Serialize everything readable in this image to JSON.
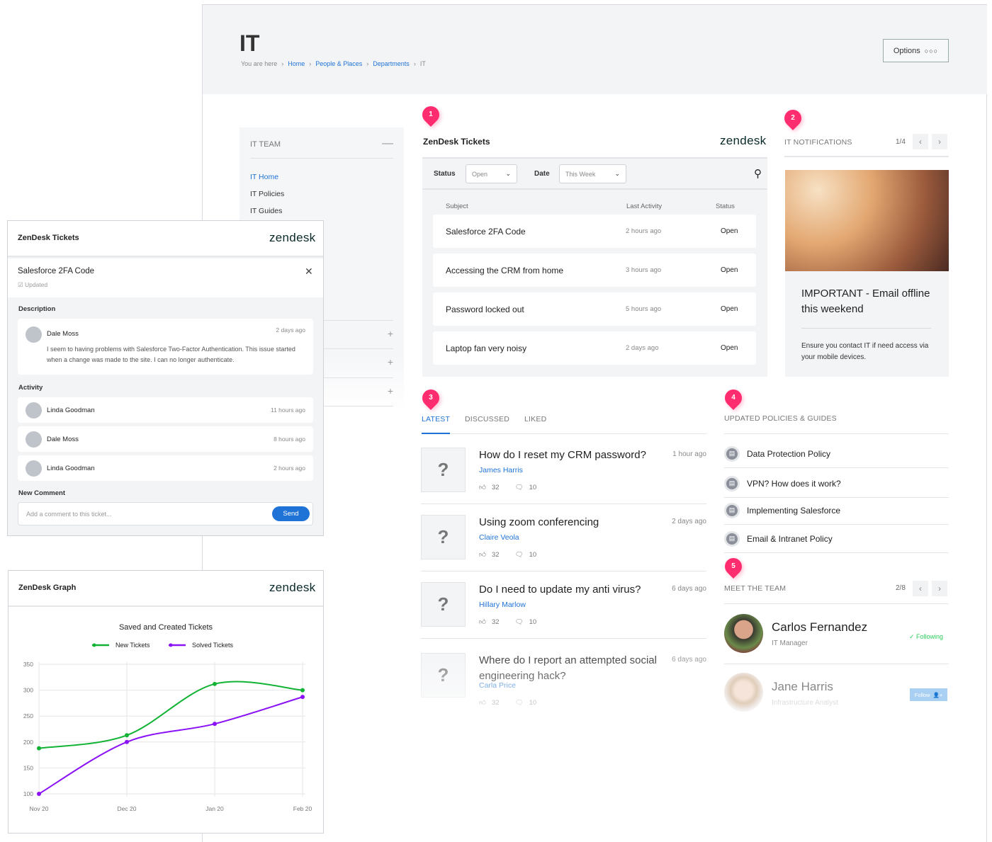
{
  "page": {
    "title": "IT",
    "breadcrumb": {
      "prefix": "You are here",
      "items": [
        "Home",
        "People & Places",
        "Departments",
        "IT"
      ]
    },
    "options_label": "Options"
  },
  "sidebar": {
    "header": "IT TEAM",
    "items": [
      {
        "label": "IT Home",
        "active": true
      },
      {
        "label": "IT Policies"
      },
      {
        "label": "IT Guides"
      }
    ]
  },
  "badges": [
    "1",
    "2",
    "3",
    "4",
    "5"
  ],
  "tickets": {
    "title": "ZenDesk Tickets",
    "logo": "zendesk",
    "status_label": "Status",
    "status_value": "Open",
    "date_label": "Date",
    "date_value": "This Week",
    "columns": [
      "Subject",
      "Last Activity",
      "Status"
    ],
    "rows": [
      {
        "subject": "Salesforce 2FA Code",
        "activity": "2 hours ago",
        "status": "Open"
      },
      {
        "subject": "Accessing the CRM from home",
        "activity": "3 hours ago",
        "status": "Open"
      },
      {
        "subject": "Password locked out",
        "activity": "5 hours ago",
        "status": "Open"
      },
      {
        "subject": "Laptop fan very noisy",
        "activity": "2 days ago",
        "status": "Open"
      }
    ]
  },
  "notifications": {
    "title": "IT NOTIFICATIONS",
    "pager": "1/4",
    "headline": "IMPORTANT - Email offline this weekend",
    "body": "Ensure you contact IT if need access via your mobile devices."
  },
  "feed": {
    "tabs": [
      "LATEST",
      "DISCUSSED",
      "LIKED"
    ],
    "active_tab": "LATEST",
    "articles": [
      {
        "q": "How do I reset my CRM password?",
        "ago": "1 hour ago",
        "author": "James Harris",
        "likes": "32",
        "comments": "10"
      },
      {
        "q": "Using zoom conferencing",
        "ago": "2 days ago",
        "author": "Claire Veola",
        "likes": "32",
        "comments": "10"
      },
      {
        "q": "Do I need to update my anti virus?",
        "ago": "6 days ago",
        "author": "Hillary Marlow",
        "likes": "32",
        "comments": "10"
      },
      {
        "q": "Where do I report an attempted social engineering hack?",
        "ago": "6 days ago",
        "author": "Carla Price",
        "likes": "32",
        "comments": "10"
      }
    ]
  },
  "policies": {
    "title": "UPDATED POLICIES & GUIDES",
    "items": [
      "Data Protection Policy",
      "VPN? How does it work?",
      "Implementing Salesforce",
      "Email & Intranet Policy"
    ]
  },
  "team": {
    "title": "MEET THE TEAM",
    "pager": "2/8",
    "members": [
      {
        "name": "Carlos Fernandez",
        "role": "IT Manager",
        "action": "Following"
      },
      {
        "name": "Jane Harris",
        "role": "Infrastructure Analyst",
        "action": "Follow"
      }
    ]
  },
  "ticket_detail": {
    "widget_title": "ZenDesk Tickets",
    "logo": "zendesk",
    "subject": "Salesforce 2FA Code",
    "state": "Updated",
    "description_label": "Description",
    "description": {
      "author": "Dale Moss",
      "time": "2 days ago",
      "text": "I seem to having problems with Salesforce Two-Factor Authentication. This issue started when a change was made to the site. I can no longer authenticate."
    },
    "activity_label": "Activity",
    "activity": [
      {
        "author": "Linda Goodman",
        "time": "11 hours ago"
      },
      {
        "author": "Dale Moss",
        "time": "8 hours ago"
      },
      {
        "author": "Linda Goodman",
        "time": "2 hours ago"
      }
    ],
    "new_comment_label": "New Comment",
    "comment_placeholder": "Add a comment to this ticket...",
    "send_label": "Send"
  },
  "graph": {
    "widget_title": "ZenDesk Graph",
    "logo": "zendesk"
  },
  "chart_data": {
    "type": "line",
    "title": "Saved and Created Tickets",
    "categories": [
      "Nov 20",
      "Dec 20",
      "Jan 20",
      "Feb 20"
    ],
    "ylim": [
      100,
      350
    ],
    "yticks": [
      "100",
      "150",
      "200",
      "250",
      "300",
      "350"
    ],
    "grid": true,
    "legend": "top",
    "series": [
      {
        "name": "New Tickets",
        "color": "#12b335",
        "values": [
          188,
          213,
          312,
          300
        ]
      },
      {
        "name": "Solved Tickets",
        "color": "#8a12f5",
        "values": [
          100,
          200,
          235,
          287
        ]
      }
    ]
  },
  "colors": {
    "accent": "#1f73d6",
    "badge": "#ff2d6f",
    "following": "#2ecc5a"
  }
}
